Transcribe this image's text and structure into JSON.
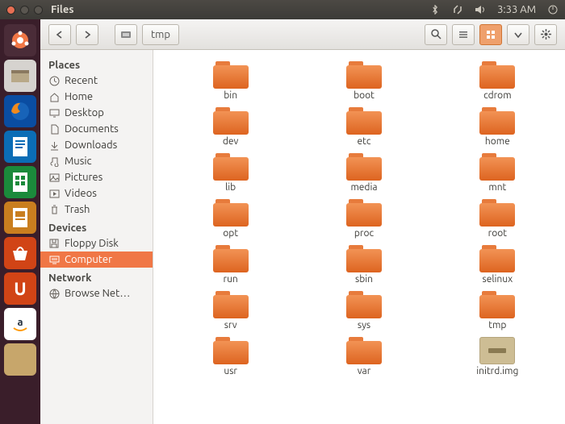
{
  "menubar": {
    "app_title": "Files",
    "time": "3:33 AM"
  },
  "toolbar": {
    "path_label": "tmp"
  },
  "sidebar": {
    "places_head": "Places",
    "places": [
      {
        "label": "Recent",
        "icon": "recent"
      },
      {
        "label": "Home",
        "icon": "home"
      },
      {
        "label": "Desktop",
        "icon": "desktop"
      },
      {
        "label": "Documents",
        "icon": "documents"
      },
      {
        "label": "Downloads",
        "icon": "downloads"
      },
      {
        "label": "Music",
        "icon": "music"
      },
      {
        "label": "Pictures",
        "icon": "pictures"
      },
      {
        "label": "Videos",
        "icon": "videos"
      },
      {
        "label": "Trash",
        "icon": "trash"
      }
    ],
    "devices_head": "Devices",
    "devices": [
      {
        "label": "Floppy Disk",
        "icon": "floppy",
        "selected": false
      },
      {
        "label": "Computer",
        "icon": "computer",
        "selected": true
      }
    ],
    "network_head": "Network",
    "network": [
      {
        "label": "Browse Net…",
        "icon": "network"
      }
    ]
  },
  "folders": [
    {
      "name": "bin",
      "type": "folder"
    },
    {
      "name": "boot",
      "type": "folder"
    },
    {
      "name": "cdrom",
      "type": "folder"
    },
    {
      "name": "dev",
      "type": "folder"
    },
    {
      "name": "etc",
      "type": "folder"
    },
    {
      "name": "home",
      "type": "folder"
    },
    {
      "name": "lib",
      "type": "folder"
    },
    {
      "name": "media",
      "type": "folder"
    },
    {
      "name": "mnt",
      "type": "folder"
    },
    {
      "name": "opt",
      "type": "folder"
    },
    {
      "name": "proc",
      "type": "folder"
    },
    {
      "name": "root",
      "type": "folder"
    },
    {
      "name": "run",
      "type": "folder"
    },
    {
      "name": "sbin",
      "type": "folder"
    },
    {
      "name": "selinux",
      "type": "folder"
    },
    {
      "name": "srv",
      "type": "folder"
    },
    {
      "name": "sys",
      "type": "folder"
    },
    {
      "name": "tmp",
      "type": "folder"
    },
    {
      "name": "usr",
      "type": "folder"
    },
    {
      "name": "var",
      "type": "folder"
    },
    {
      "name": "initrd.img",
      "type": "file"
    }
  ]
}
